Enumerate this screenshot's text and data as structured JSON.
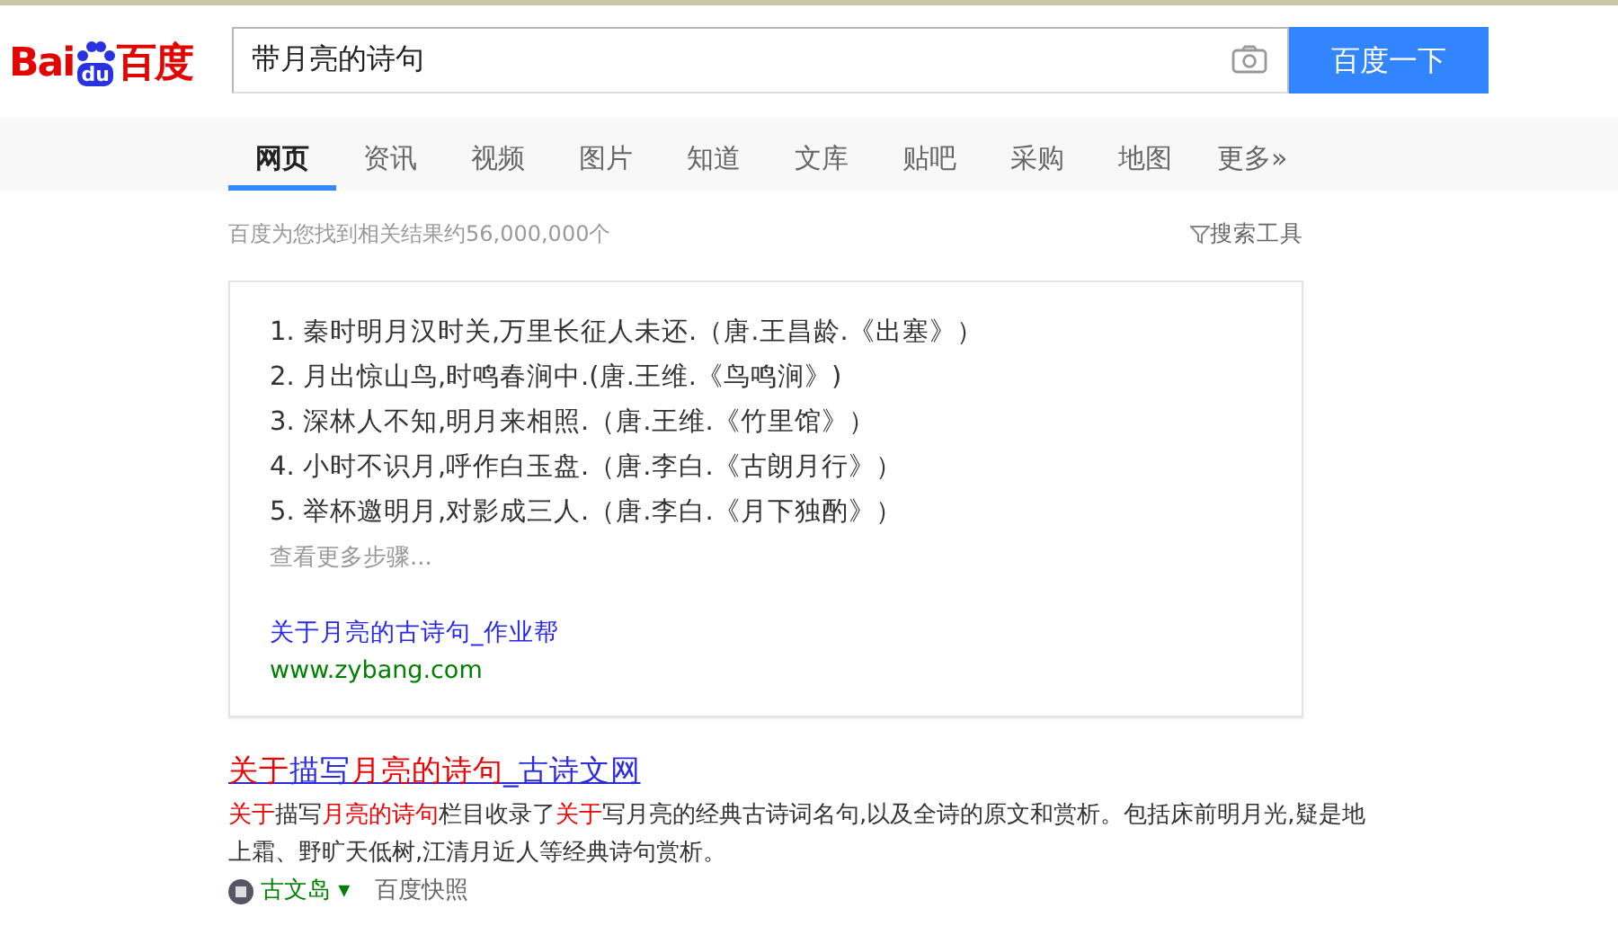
{
  "logo": {
    "text_left": "Bai",
    "text_paw": "du",
    "text_right": "百度"
  },
  "search": {
    "value": "带月亮的诗句",
    "button": "百度一下"
  },
  "tabs": [
    {
      "label": "网页",
      "selected": true
    },
    {
      "label": "资讯",
      "selected": false
    },
    {
      "label": "视频",
      "selected": false
    },
    {
      "label": "图片",
      "selected": false
    },
    {
      "label": "知道",
      "selected": false
    },
    {
      "label": "文库",
      "selected": false
    },
    {
      "label": "贴吧",
      "selected": false
    },
    {
      "label": "采购",
      "selected": false
    },
    {
      "label": "地图",
      "selected": false
    },
    {
      "label": "更多»",
      "selected": false
    }
  ],
  "result_count": "百度为您找到相关结果约56,000,000个",
  "search_tools": "搜索工具",
  "answer_card": {
    "lines": [
      "1. 秦时明月汉时关,万里长征人未还.（唐.王昌龄.《出塞》）",
      "2. 月出惊山鸟,时鸣春涧中.(唐.王维.《鸟鸣涧》)",
      "3. 深林人不知,明月来相照.（唐.王维.《竹里馆》）",
      "4. 小时不识月,呼作白玉盘.（唐.李白.《古朗月行》）",
      "5. 举杯邀明月,对影成三人.（唐.李白.《月下独酌》）"
    ],
    "more": "查看更多步骤...",
    "source_title": "关于月亮的古诗句_作业帮",
    "source_url": "www.zybang.com"
  },
  "results": [
    {
      "title": [
        {
          "text": "关于",
          "highlight": true
        },
        {
          "text": "描写",
          "highlight": false
        },
        {
          "text": "月亮的诗句",
          "highlight": true
        },
        {
          "text": "_古诗文网",
          "highlight": false
        }
      ],
      "description": [
        {
          "text": "关于",
          "highlight": true
        },
        {
          "text": "描写",
          "highlight": false
        },
        {
          "text": "月亮的诗句",
          "highlight": true
        },
        {
          "text": "栏目收录了",
          "highlight": false
        },
        {
          "text": "关于",
          "highlight": true
        },
        {
          "text": "写月亮的经典古诗词名句,以及全诗的原文和赏析。包括床前明月光,疑是地上霜、野旷天低树,江清月近人等经典诗句赏析。",
          "highlight": false
        }
      ],
      "site": "古文岛",
      "site_caret": "▾",
      "snapshot": "百度快照"
    }
  ]
}
